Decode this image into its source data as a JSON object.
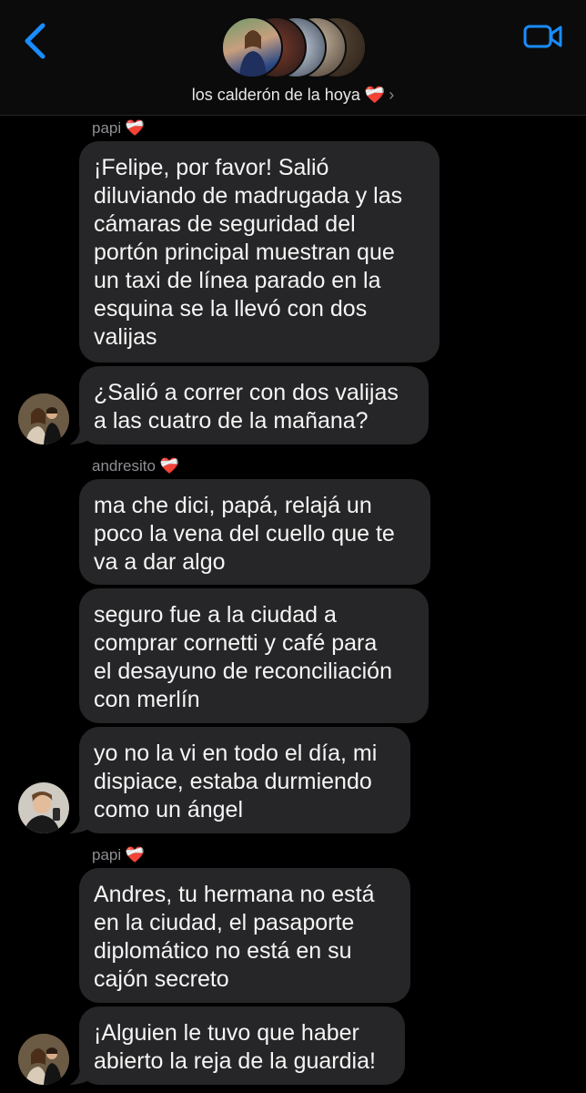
{
  "header": {
    "group_name": "los calderón de la hoya ❤️‍🩹",
    "chevron": "›",
    "back_icon": "chevron-left-icon",
    "video_icon": "video-camera-icon",
    "accent_color": "#1a8cff"
  },
  "messages": [
    {
      "sender": "papi ❤️‍🩹",
      "lines": [
        "¡Felipe, por favor! Salió",
        "diluviando de madrugada y las",
        "cámaras de seguridad del",
        "portón principal muestran que",
        "un taxi de línea parado en la",
        "esquina se la llevó con dos",
        "valijas"
      ]
    },
    {
      "lines": [
        "¿Salió a correr con dos valijas",
        "a las cuatro de la mañana?"
      ]
    },
    {
      "sender": "andresito ❤️‍🩹",
      "lines": [
        "ma che dici, papá, relajá un",
        "poco la vena del cuello que te",
        "va a dar algo"
      ]
    },
    {
      "lines": [
        "seguro fue a la ciudad a",
        "comprar cornetti y café para",
        "el desayuno de reconciliación",
        "con merlín"
      ]
    },
    {
      "lines": [
        "yo no la vi en todo el día, mi",
        "dispiace, estaba durmiendo",
        "como un ángel"
      ]
    },
    {
      "sender": "papi ❤️‍🩹",
      "lines": [
        "Andres, tu hermana no está",
        "en la ciudad, el pasaporte",
        "diplomático no está en su",
        "cajón secreto"
      ]
    },
    {
      "lines": [
        "¡Alguien le tuvo que haber",
        "abierto la reja de la guardia!"
      ]
    }
  ]
}
